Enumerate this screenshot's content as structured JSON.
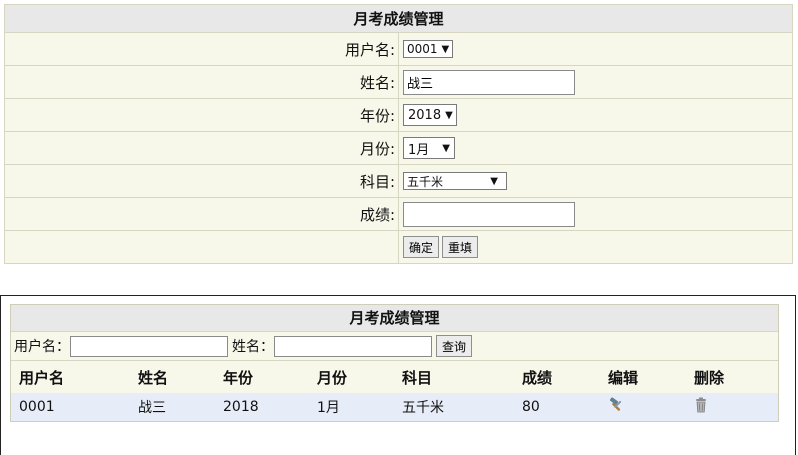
{
  "form": {
    "title": "月考成绩管理",
    "username": {
      "label": "用户名:",
      "value": "0001"
    },
    "name": {
      "label": "姓名:",
      "value": "战三"
    },
    "year": {
      "label": "年份:",
      "value": "2018"
    },
    "month": {
      "label": "月份:",
      "value": "1月"
    },
    "subject": {
      "label": "科目:",
      "value": "五千米"
    },
    "score": {
      "label": "成绩:",
      "value": ""
    },
    "confirm_label": "确定",
    "reset_label": "重填"
  },
  "list": {
    "title": "月考成绩管理",
    "search": {
      "username_label": "用户名：",
      "name_label": "姓名：",
      "query_label": "查询"
    },
    "columns": [
      "用户名",
      "姓名",
      "年份",
      "月份",
      "科目",
      "成绩",
      "编辑",
      "删除"
    ],
    "rows": [
      {
        "username": "0001",
        "name": "战三",
        "year": "2018",
        "month": "1月",
        "subject": "五千米",
        "score": "80"
      }
    ],
    "edit_icon": "hammer-icon",
    "delete_icon": "trash-icon"
  }
}
